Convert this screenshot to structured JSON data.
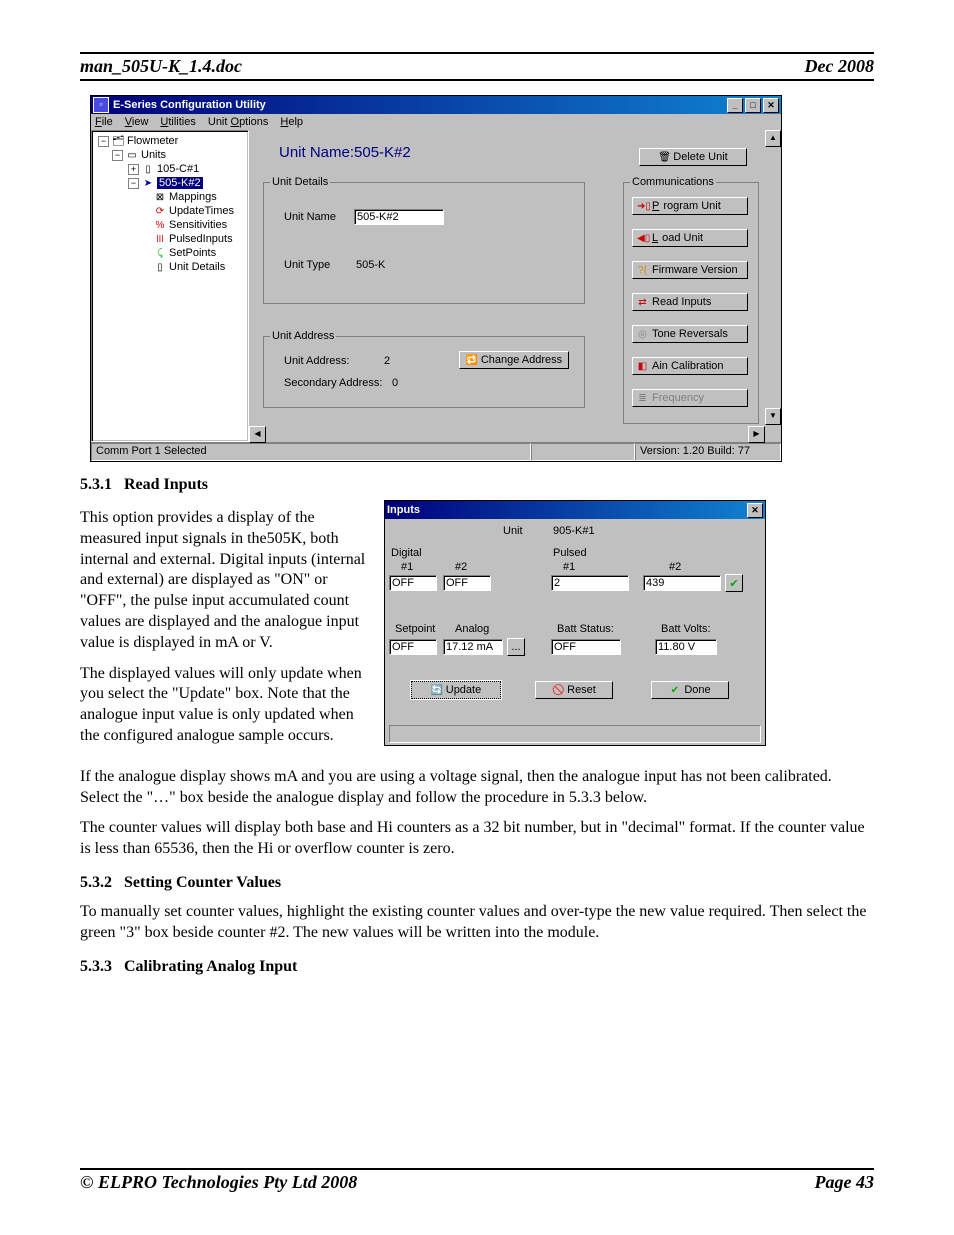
{
  "header": {
    "left": "man_505U-K_1.4.doc",
    "right": "Dec 2008"
  },
  "footer": {
    "left": "© ELPRO Technologies Pty Ltd 2008",
    "right": "Page 43"
  },
  "cfg": {
    "title": "E-Series Configuration Utility",
    "menus": {
      "file": "File",
      "view": "View",
      "util": "Utilities",
      "uopt": "Unit Options",
      "help": "Help"
    },
    "tree": {
      "root": "Flowmeter",
      "units": "Units",
      "u1": "105-C#1",
      "u2": "505-K#2",
      "map": "Mappings",
      "upd": "UpdateTimes",
      "sens": "Sensitivities",
      "pulsed": "PulsedInputs",
      "setp": "SetPoints",
      "udet": "Unit Details"
    },
    "main": {
      "heading": "Unit Name:505-K#2",
      "udet_legend": "Unit Details",
      "uname_lbl": "Unit Name",
      "uname_val": "505-K#2",
      "utype_lbl": "Unit Type",
      "utype_val": "505-K",
      "uaddr_legend": "Unit Address",
      "uaddr_lbl": "Unit Address:",
      "uaddr_val": "2",
      "saddr_lbl": "Secondary Address:",
      "saddr_val": "0",
      "chg_addr": "Change Address"
    },
    "sidebtns": {
      "delete": "Delete Unit",
      "comm": "Communications",
      "prog": "Program Unit",
      "load": "Load Unit",
      "fw": "Firmware Version",
      "read": "Read Inputs",
      "tone": "Tone Reversals",
      "ain": "Ain Calibration",
      "freq": "Frequency"
    },
    "status": {
      "left": "Comm Port 1 Selected",
      "right": "Version: 1.20 Build: 77"
    }
  },
  "sections": {
    "s531": "5.3.1",
    "s531t": "Read Inputs",
    "s531p1": "This option provides a display of the measured input signals in the505K, both internal and external.   Digital inputs (internal and external) are displayed as \"ON\" or \"OFF\",  the pulse input accumulated count values are displayed and the analogue input value is displayed in mA or V.",
    "s531p2": "The displayed values will only update when you select the \"Update\" box.  Note that the analogue input value is only updated when the configured analogue sample occurs.",
    "s531p3": "If the analogue display shows mA and you are using a voltage signal,  then the analogue input has not been calibrated.  Select the \"…\" box beside the analogue display and follow the procedure in 5.3.3 below.",
    "s531p4": "The counter values will display both base and Hi counters as a 32 bit number,  but in \"decimal\" format.  If the counter value is less than 65536,  then the Hi or overflow counter is zero.",
    "s532": "5.3.2",
    "s532t": "Setting Counter Values",
    "s532p1": "To manually set counter values,  highlight the existing counter values and over-type the new value required. Then select the green \"3\" box beside counter #2.  The new values will be written into the module.",
    "s533": "5.3.3",
    "s533t": "Calibrating Analog Input"
  },
  "inputs": {
    "title": "Inputs",
    "unit_lbl": "Unit",
    "unit_val": "905-K#1",
    "dig": "Digital",
    "n1": "#1",
    "n2": "#2",
    "d1": "OFF",
    "d2": "OFF",
    "pulsed": "Pulsed",
    "p1": "2",
    "p2": "439",
    "sp": "Setpoint",
    "sp_v": "OFF",
    "an": "Analog",
    "an_v": "17.12 mA",
    "bs": "Batt Status:",
    "bs_v": "OFF",
    "bv": "Batt Volts:",
    "bv_v": "11.80 V",
    "update": "Update",
    "reset": "Reset",
    "done": "Done",
    "dots": "..."
  }
}
